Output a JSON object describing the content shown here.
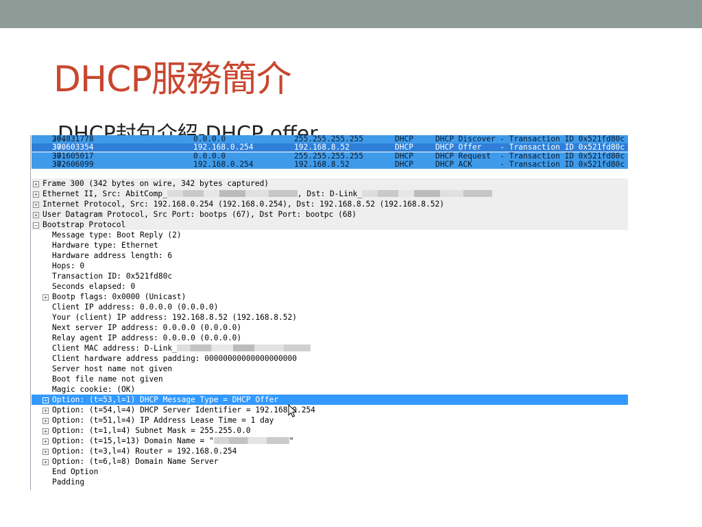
{
  "slide": {
    "title": "DHCP服務簡介",
    "subtitle": "DHCP封包介紹-DHCP offer"
  },
  "packet_list": {
    "rows": [
      {
        "no": "294",
        "time": "36.831778",
        "source": "0.0.0.0",
        "destination": "255.255.255.255",
        "protocol": "DHCP",
        "info": "DHCP Discover - Transaction ID 0x521fd80c",
        "selected": false
      },
      {
        "no": "300",
        "time": "37.603354",
        "source": "192.168.0.254",
        "destination": "192.168.8.52",
        "protocol": "DHCP",
        "info": "DHCP Offer    - Transaction ID 0x521fd80c",
        "selected": true
      },
      {
        "no": "301",
        "time": "37.605017",
        "source": "0.0.0.0",
        "destination": "255.255.255.255",
        "protocol": "DHCP",
        "info": "DHCP Request  - Transaction ID 0x521fd80c",
        "selected": false
      },
      {
        "no": "302",
        "time": "37.606099",
        "source": "192.168.0.254",
        "destination": "192.168.8.52",
        "protocol": "DHCP",
        "info": "DHCP ACK      - Transaction ID 0x521fd80c",
        "selected": false
      }
    ]
  },
  "details": {
    "frame": "Frame 300 (342 bytes on wire, 342 bytes captured)",
    "ethernet_prefix": "Ethernet II, Src: AbitComp_",
    "ethernet_mid": ", Dst: D-Link_",
    "ip": "Internet Protocol, Src: 192.168.0.254 (192.168.0.254), Dst: 192.168.8.52 (192.168.8.52)",
    "udp": "User Datagram Protocol, Src Port: bootps (67), Dst Port: bootpc (68)",
    "bootstrap": "Bootstrap Protocol",
    "message_type": "Message type: Boot Reply (2)",
    "hw_type": "Hardware type: Ethernet",
    "hw_len": "Hardware address length: 6",
    "hops": "Hops: 0",
    "xid": "Transaction ID: 0x521fd80c",
    "secs": "Seconds elapsed: 0",
    "flags": "Bootp flags: 0x0000 (Unicast)",
    "ciaddr": "Client IP address: 0.0.0.0 (0.0.0.0)",
    "yiaddr": "Your (client) IP address: 192.168.8.52 (192.168.8.52)",
    "siaddr": "Next server IP address: 0.0.0.0 (0.0.0.0)",
    "giaddr": "Relay agent IP address: 0.0.0.0 (0.0.0.0)",
    "chaddr": "Client MAC address: D-Link_",
    "padding_hw": "Client hardware address padding: 00000000000000000000",
    "sname": "Server host name not given",
    "file": "Boot file name not given",
    "magic": "Magic cookie: (OK)",
    "opt53": "Option: (t=53,l=1) DHCP Message Type = DHCP Offer",
    "opt54": "Option: (t=54,l=4) DHCP Server Identifier = 192.168.0.254",
    "opt51": "Option: (t=51,l=4) IP Address Lease Time = 1 day",
    "opt1": "Option: (t=1,l=4) Subnet Mask = 255.255.0.0",
    "opt15_prefix": "Option: (t=15,l=13) Domain Name = \"",
    "opt15_suffix": "\"",
    "opt3": "Option: (t=3,l=4) Router = 192.168.0.254",
    "opt6": "Option: (t=6,l=8) Domain Name Server",
    "end": "End Option",
    "pad": "Padding"
  },
  "icons": {
    "expand": "plus-box-icon",
    "collapse": "minus-box-icon",
    "cursor": "mouse-pointer-icon"
  },
  "colors": {
    "title": "#c8472f",
    "topbar": "#8e9c98",
    "packet_row": "#3f9bea",
    "selection": "#3399ff"
  }
}
